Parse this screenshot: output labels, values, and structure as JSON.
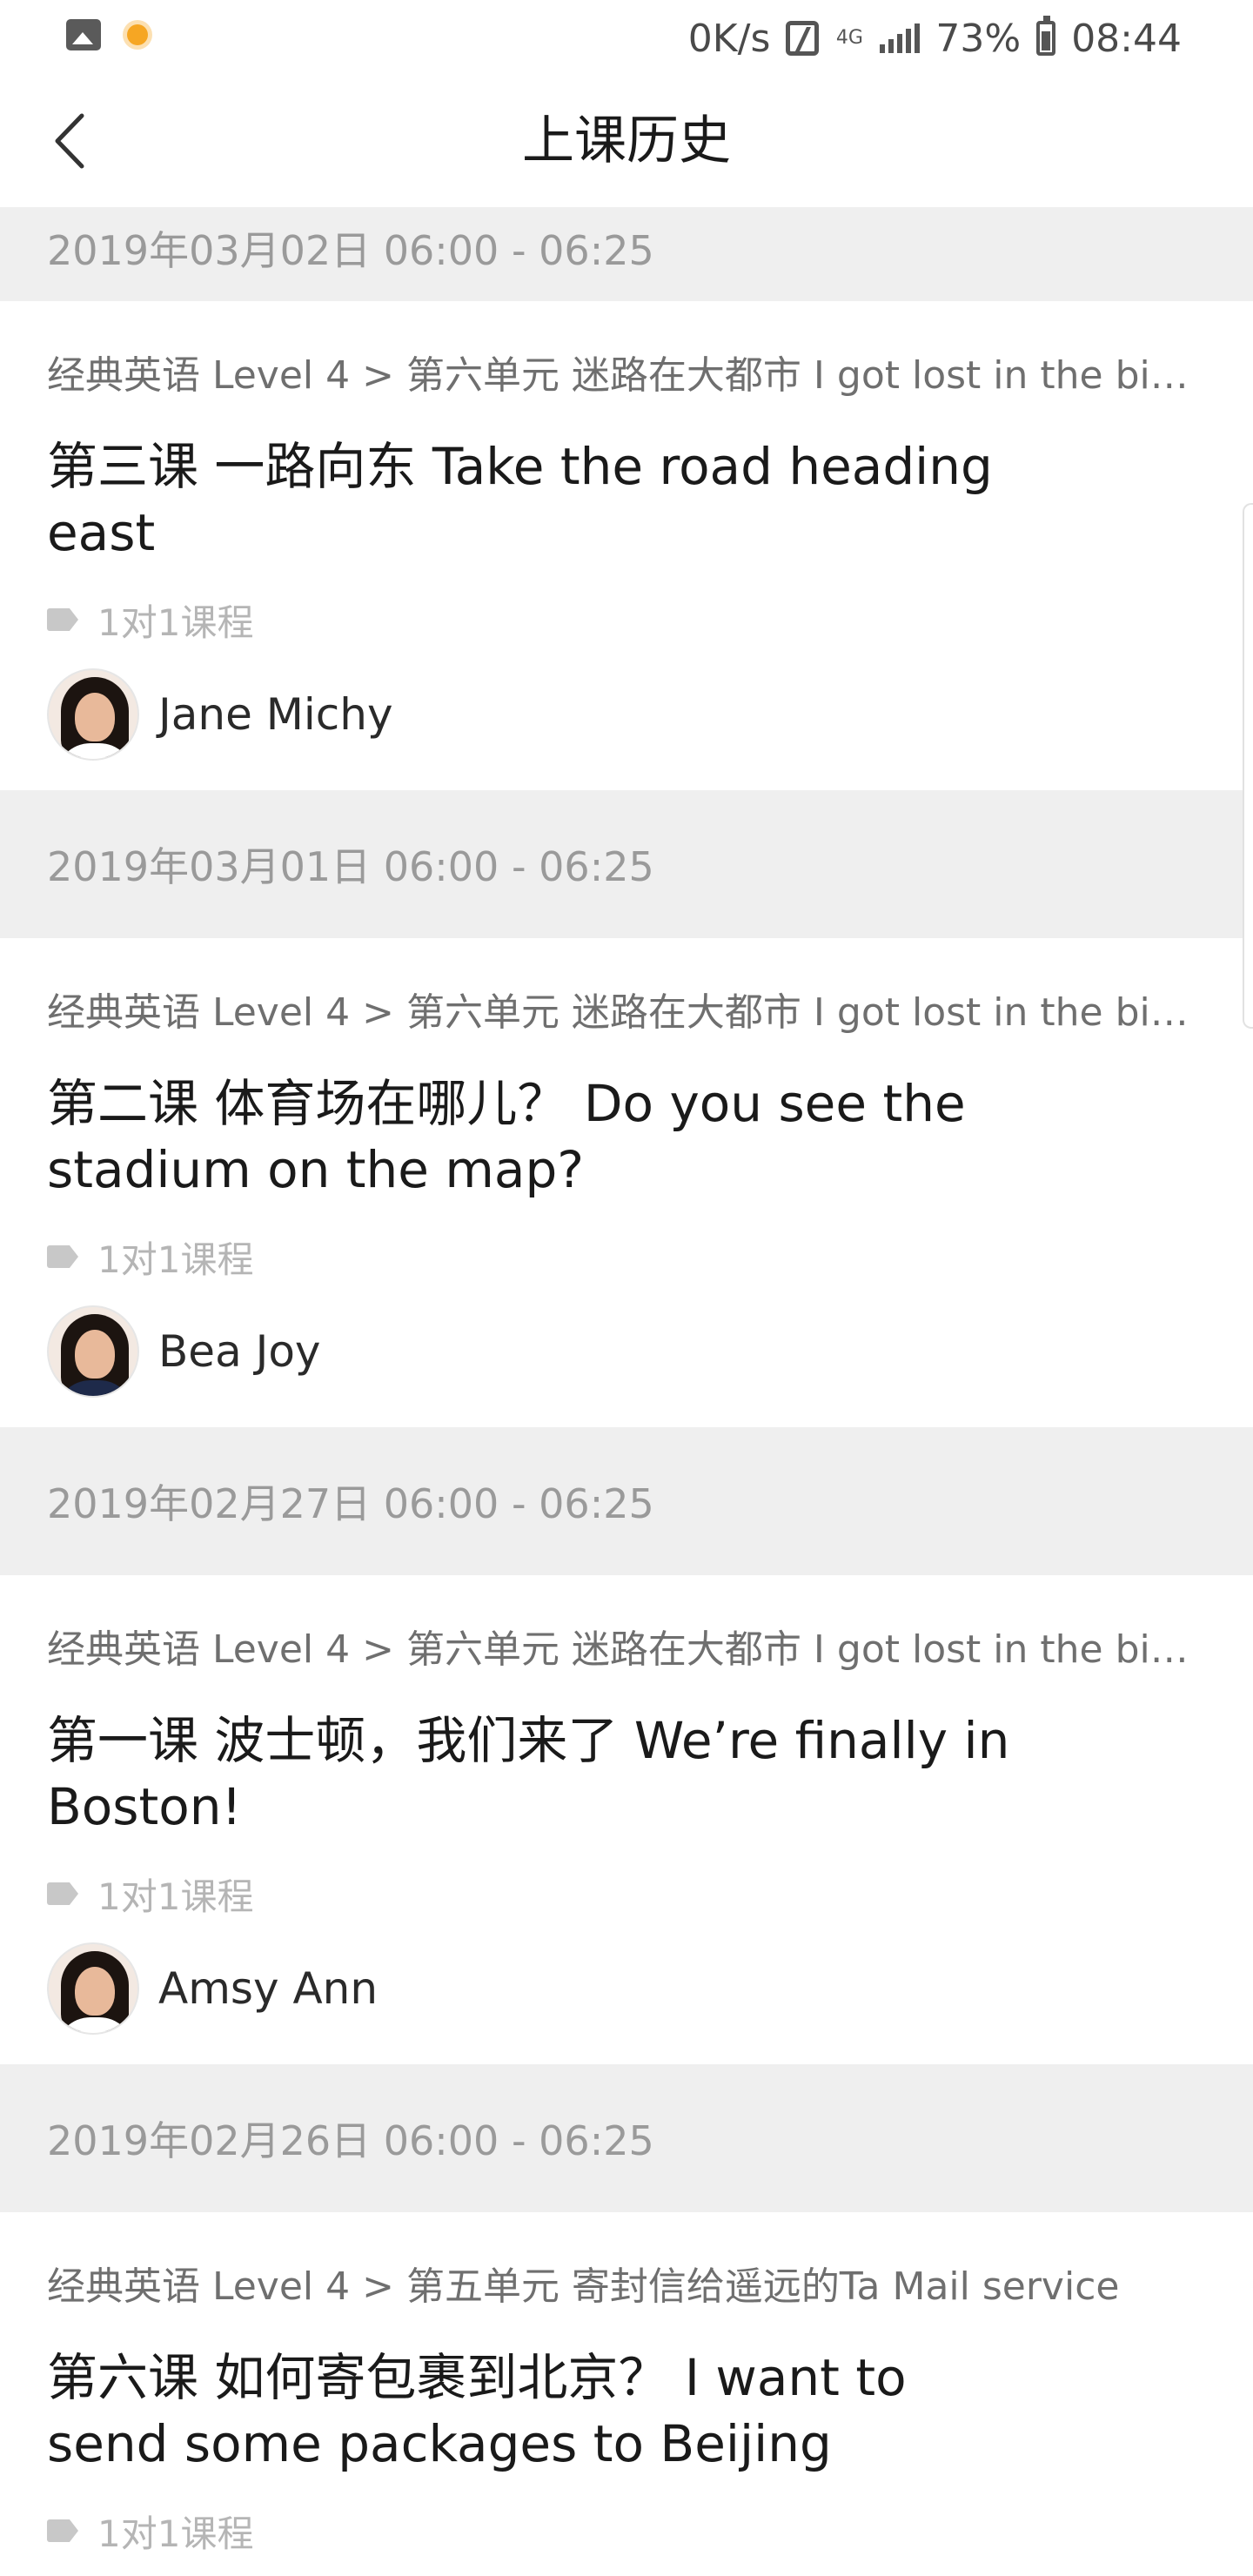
{
  "status_bar": {
    "speed": "0K/s",
    "network": "4G",
    "battery": "73%",
    "time": "08:44"
  },
  "header": {
    "title": "上课历史"
  },
  "sessions": [
    {
      "date": "2019年03月02日 06:00 - 06:25",
      "course_path": "经典英语 Level 4 > 第六单元 迷路在大都市 I got lost in the bi…",
      "lesson": "第三课 一路向东 Take the road heading east",
      "tag": "1对1课程",
      "teacher": "Jane Michy"
    },
    {
      "date": "2019年03月01日 06:00 - 06:25",
      "course_path": "经典英语 Level 4 > 第六单元 迷路在大都市 I got lost in the bi…",
      "lesson": "第二课 体育场在哪儿？ Do you see the stadium on the map?",
      "tag": "1对1课程",
      "teacher": "Bea Joy"
    },
    {
      "date": "2019年02月27日 06:00 - 06:25",
      "course_path": "经典英语 Level 4 > 第六单元 迷路在大都市 I got lost in the bi…",
      "lesson": "第一课 波士顿，我们来了 We’re finally in Boston!",
      "tag": "1对1课程",
      "teacher": "Amsy Ann"
    },
    {
      "date": "2019年02月26日 06:00 - 06:25",
      "course_path": "经典英语 Level 4 > 第五单元 寄封信给遥远的Ta Mail service",
      "lesson": "第六课 如何寄包裹到北京？ I want to send some packages to Beijing",
      "tag": "1对1课程"
    }
  ]
}
